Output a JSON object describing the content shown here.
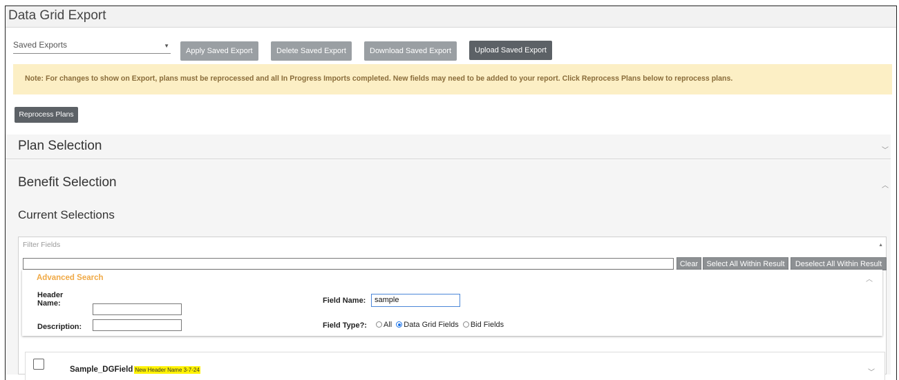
{
  "window": {
    "title": "Data Grid Export"
  },
  "toolbar": {
    "saved_exports_placeholder": "Saved Exports",
    "apply_label": "Apply Saved Export",
    "delete_label": "Delete Saved Export",
    "download_label": "Download Saved Export",
    "upload_label": "Upload Saved Export"
  },
  "note": {
    "text": "Note: For changes to show on Export, plans must be reprocessed and all In Progress Imports completed. New fields may need to be added to your report. Click Reprocess Plans below to reprocess plans."
  },
  "reprocess_label": "Reprocess Plans",
  "plan_selection": {
    "title": "Plan Selection"
  },
  "benefit_selection": {
    "title": "Benefit Selection",
    "current_selections": "Current Selections",
    "filter_fields_label": "Filter Fields",
    "search_value": "",
    "buttons": {
      "clear": "Clear",
      "select_all": "Select All Within Result",
      "deselect_all": "Deselect All Within Result"
    },
    "advanced_search": {
      "title": "Advanced Search",
      "header_name_label_1": "Header",
      "header_name_label_2": "Name:",
      "description_label": "Description:",
      "field_name_label": "Field Name:",
      "field_name_value": "sample",
      "field_type_label": "Field Type?:",
      "field_type_options": [
        "All",
        "Data Grid Fields",
        "Bid Fields"
      ],
      "field_type_selected": "Data Grid Fields"
    },
    "results": [
      {
        "name": "Sample_DGField",
        "highlight": "New Header Name 3-7-24"
      }
    ]
  },
  "colors": {
    "note_bg": "#fcefc5",
    "note_text": "#8a6d3b",
    "advanced_title": "#f0a945",
    "highlight": "#fff200"
  },
  "icons": {
    "dropdown": "caret-down-icon",
    "collapse": "chevron-down-icon",
    "expand": "chevron-up-icon"
  }
}
